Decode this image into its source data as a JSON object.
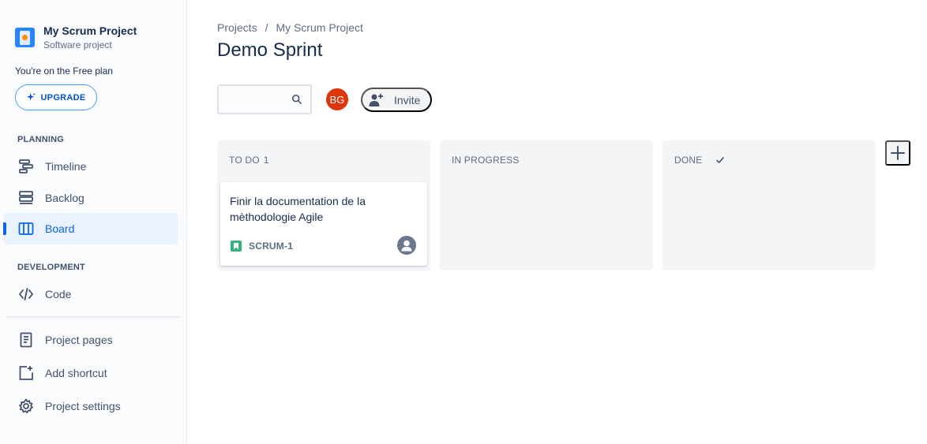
{
  "project": {
    "name": "My Scrum Project",
    "type": "Software project"
  },
  "plan": {
    "text": "You're on the Free plan",
    "upgrade_label": "UPGRADE"
  },
  "sidebar": {
    "planning_label": "PLANNING",
    "development_label": "DEVELOPMENT",
    "items": [
      {
        "label": "Timeline",
        "icon": "timeline-icon"
      },
      {
        "label": "Backlog",
        "icon": "backlog-icon"
      },
      {
        "label": "Board",
        "icon": "board-icon",
        "active": true
      },
      {
        "label": "Code",
        "icon": "code-icon"
      },
      {
        "label": "Project pages",
        "icon": "page-icon"
      },
      {
        "label": "Add shortcut",
        "icon": "add-shortcut-icon"
      },
      {
        "label": "Project settings",
        "icon": "gear-icon"
      }
    ]
  },
  "breadcrumb": {
    "root": "Projects",
    "separator": "/",
    "current": "My Scrum Project"
  },
  "page_title": "Demo Sprint",
  "search": {
    "value": "",
    "placeholder": ""
  },
  "members": {
    "avatar_initials": "BG",
    "avatar_color": "#de350b",
    "invite_label": "Invite"
  },
  "board": {
    "columns": [
      {
        "name": "TO DO",
        "count": "1"
      },
      {
        "name": "IN PROGRESS",
        "count": ""
      },
      {
        "name": "DONE",
        "count": ""
      }
    ],
    "cards": [
      {
        "title": "Finir la documentation de la mèthodologie Agile",
        "key": "SCRUM-1",
        "type_icon": "story-icon",
        "assignee_icon": "unassigned-avatar-icon"
      }
    ]
  },
  "colors": {
    "accent": "#0c66e4",
    "story": "#36b37e"
  }
}
